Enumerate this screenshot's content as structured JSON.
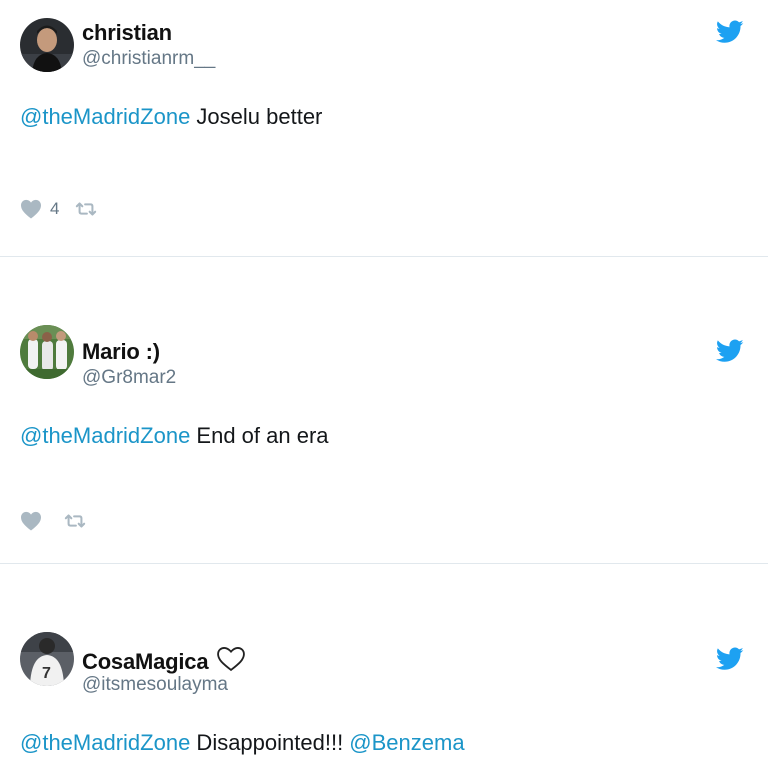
{
  "colors": {
    "accent": "#1da1f2",
    "mention": "#1b95c8",
    "handle": "#657786",
    "action_icon": "#aab8c2",
    "divider": "#e1e8ed"
  },
  "tweets": [
    {
      "display_name": "christian",
      "handle": "@christianrm__",
      "mention": "@theMadridZone",
      "text": " Joselu better",
      "like_count": "4",
      "icons": [
        "avatar-photo",
        "twitter-bird-icon",
        "heart-icon",
        "retweet-icon"
      ]
    },
    {
      "display_name": "Mario :)",
      "handle": "@Gr8mar2",
      "mention": "@theMadridZone",
      "text": " End of an era",
      "like_count": "",
      "icons": [
        "avatar-photo",
        "twitter-bird-icon",
        "heart-icon",
        "retweet-icon"
      ]
    },
    {
      "display_name": "CosaMagica",
      "handle": "@itsmesoulayma",
      "mention": "@theMadridZone",
      "text": " Disappointed!!! ",
      "mention2": "@Benzema",
      "icons": [
        "avatar-photo",
        "heart-outline-icon",
        "twitter-bird-icon"
      ]
    }
  ]
}
